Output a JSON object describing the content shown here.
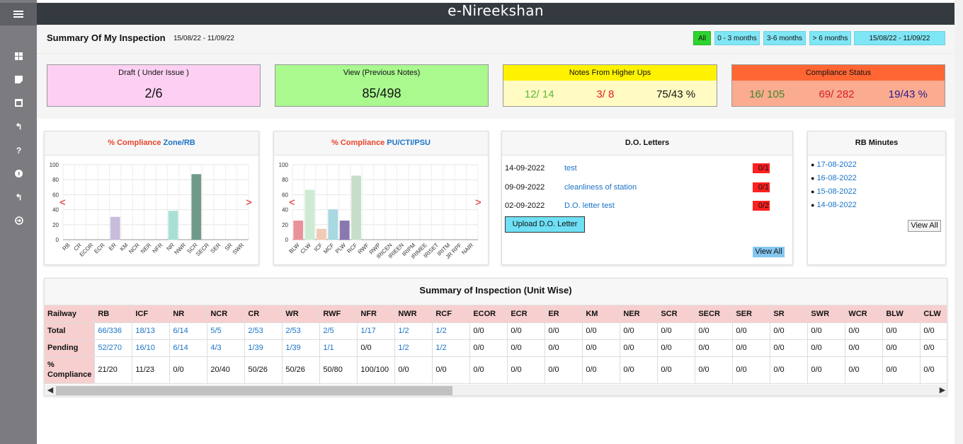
{
  "app": {
    "title": "e-Nireekshan"
  },
  "sidebar": {
    "icons": [
      "dashboard-icon",
      "note-icon",
      "document-icon",
      "back-icon",
      "help-icon",
      "info-icon",
      "reply-icon",
      "logout-icon"
    ]
  },
  "header": {
    "title": "Summary Of My Inspection",
    "date_range": "15/08/22 - 11/09/22",
    "filters": [
      "All",
      "0 - 3 months",
      "3-6 months",
      "> 6 months",
      "15/08/22 - 11/09/22"
    ]
  },
  "cards": {
    "draft": {
      "title": "Draft ( Under Issue )",
      "value": "2/6",
      "color": "#fdd0f3"
    },
    "view": {
      "title": "View (Previous Notes)",
      "value": "85/498",
      "color": "#a9f98f"
    },
    "notes": {
      "title": "Notes From Higher Ups",
      "v1": "12/ 14",
      "v2": "3/ 8",
      "v3": "75/43 %",
      "color": "#fff200"
    },
    "compliance": {
      "title": "Compliance Status",
      "v1": "16/ 105",
      "v2": "69/ 282",
      "v3": "19/43 %",
      "color": "#ff6633"
    }
  },
  "zone_chart": {
    "title_prefix": "% Compliance",
    "title_suffix": "Zone/RB",
    "nav_prev": "<",
    "nav_next": ">"
  },
  "pu_chart": {
    "title_prefix": "% Compliance",
    "title_suffix": "PU/CTI/PSU",
    "nav_prev": "<",
    "nav_next": ">"
  },
  "chart_data": [
    {
      "type": "bar",
      "categories": [
        "RB",
        "CR",
        "ECOR",
        "ECR",
        "ER",
        "KM",
        "NCR",
        "NER",
        "NFR",
        "NR",
        "NWR",
        "SCR",
        "SECR",
        "SER",
        "SR",
        "SWR"
      ],
      "values": [
        0,
        0,
        0,
        0,
        30,
        0,
        0,
        0,
        0,
        38,
        0,
        87,
        0,
        0,
        0,
        0
      ],
      "colors": [
        "#c4b4d4",
        "#c4b4d4",
        "#c4b4d4",
        "#c4b4d4",
        "#c9bcdb",
        "#c4b4d4",
        "#c4b4d4",
        "#c4b4d4",
        "#c4b4d4",
        "#a8e0d6",
        "#c4b4d4",
        "#6f9a8a",
        "#c4b4d4",
        "#c4b4d4",
        "#c4b4d4",
        "#c4b4d4"
      ],
      "ylim": [
        0,
        100
      ],
      "yticks": [
        0,
        20,
        40,
        60,
        80,
        100
      ]
    },
    {
      "type": "bar",
      "categories": [
        "BLW",
        "CLW",
        "ICF",
        "MCF",
        "PLW",
        "RCF",
        "RWF",
        "RWP",
        "IRICEN",
        "IRIEEN",
        "IRIPM",
        "IRIMEE",
        "IRISET",
        "IRITM",
        "JR RPF",
        "NAIR"
      ],
      "values": [
        25,
        66,
        14,
        40,
        25,
        85,
        0,
        0,
        0,
        0,
        0,
        0,
        0,
        0,
        0,
        0
      ],
      "colors": [
        "#e8939a",
        "#cdebd3",
        "#f0cbb5",
        "#a8d8e0",
        "#8a78b0",
        "#c7dfc8",
        "#ccc",
        "#ccc",
        "#ccc",
        "#ccc",
        "#ccc",
        "#ccc",
        "#ccc",
        "#ccc",
        "#ccc",
        "#ccc"
      ],
      "ylim": [
        0,
        100
      ],
      "yticks": [
        0,
        20,
        40,
        60,
        80,
        100
      ]
    }
  ],
  "do_letters": {
    "title": "D.O. Letters",
    "rows": [
      {
        "date": "14-09-2022",
        "subject": "test",
        "badge": "0/1"
      },
      {
        "date": "09-09-2022",
        "subject": "cleanliness of station",
        "badge": "0/1"
      },
      {
        "date": "02-09-2022",
        "subject": "D.O. letter test",
        "badge": "0/2"
      }
    ],
    "upload_label": "Upload D.O. Letter",
    "view_all_label": "View All"
  },
  "rb_minutes": {
    "title": "RB Minutes",
    "items": [
      "17-08-2022",
      "16-08-2022",
      "15-08-2022",
      "14-08-2022"
    ],
    "view_all_label": "View All"
  },
  "unit_table": {
    "title": "Summary of Inspection (Unit Wise)",
    "header_label": "Railway",
    "columns": [
      "RB",
      "ICF",
      "NR",
      "NCR",
      "CR",
      "WR",
      "RWF",
      "NFR",
      "NWR",
      "RCF",
      "ECOR",
      "ECR",
      "ER",
      "KM",
      "NER",
      "SCR",
      "SECR",
      "SER",
      "SR",
      "SWR",
      "WCR",
      "BLW",
      "CLW"
    ],
    "rows": [
      {
        "label": "Total",
        "values": [
          "66/336",
          "18/13",
          "6/14",
          "5/5",
          "2/53",
          "2/53",
          "2/5",
          "1/17",
          "1/2",
          "1/2",
          "0/0",
          "0/0",
          "0/0",
          "0/0",
          "0/0",
          "0/0",
          "0/0",
          "0/0",
          "0/0",
          "0/0",
          "0/0",
          "0/0",
          "0/0"
        ]
      },
      {
        "label": "Pending",
        "values": [
          "52/270",
          "16/10",
          "6/14",
          "4/3",
          "1/39",
          "1/39",
          "1/1",
          "0/0",
          "1/2",
          "1/2",
          "0/0",
          "0/0",
          "0/0",
          "0/0",
          "0/0",
          "0/0",
          "0/0",
          "0/0",
          "0/0",
          "0/0",
          "0/0",
          "0/0",
          "0/0"
        ]
      },
      {
        "label": "% Compliance",
        "values": [
          "21/20",
          "11/23",
          "0/0",
          "20/40",
          "50/26",
          "50/26",
          "50/80",
          "100/100",
          "0/0",
          "0/0",
          "0/0",
          "0/0",
          "0/0",
          "0/0",
          "0/0",
          "0/0",
          "0/0",
          "0/0",
          "0/0",
          "0/0",
          "0/0",
          "0/0",
          "0/0"
        ]
      }
    ],
    "link_rows": [
      true,
      true,
      false
    ]
  }
}
